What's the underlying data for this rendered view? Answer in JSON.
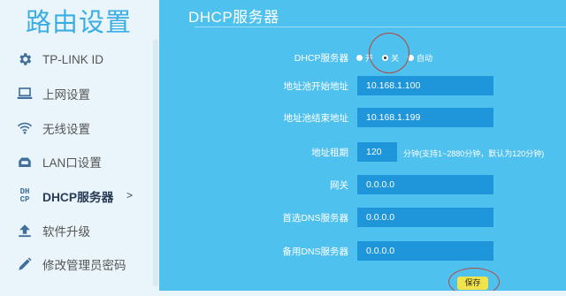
{
  "sidebar": {
    "title": "路由设置",
    "items": [
      {
        "label": "TP-LINK ID",
        "icon": "gear-icon"
      },
      {
        "label": "上网设置",
        "icon": "laptop-icon"
      },
      {
        "label": "无线设置",
        "icon": "wifi-icon"
      },
      {
        "label": "LAN口设置",
        "icon": "lan-port-icon"
      },
      {
        "label": "DHCP服务器",
        "icon": "dhcp-icon",
        "icon_text_top": "DH",
        "icon_text_bottom": "CP",
        "arrow": ">",
        "active": true
      },
      {
        "label": "软件升级",
        "icon": "upload-icon"
      },
      {
        "label": "修改管理员密码",
        "icon": "pencil-icon"
      }
    ]
  },
  "main": {
    "title": "DHCP服务器",
    "dhcp_server": {
      "label": "DHCP服务器",
      "options": [
        "开",
        "关",
        "自动"
      ],
      "selected": "关"
    },
    "fields": [
      {
        "label": "地址池开始地址",
        "value": "10.168.1.100"
      },
      {
        "label": "地址池结束地址",
        "value": "10.168.1.199"
      },
      {
        "label": "地址租期",
        "value": "120",
        "hint": "分钟(支持1~2880分钟，默认为120分钟)"
      },
      {
        "label": "网关",
        "value": "0.0.0.0"
      },
      {
        "label": "首选DNS服务器",
        "value": "0.0.0.0"
      },
      {
        "label": "备用DNS服务器",
        "value": "0.0.0.0"
      }
    ],
    "save_label": "保存"
  },
  "colors": {
    "background": "#4fc1ee",
    "input_bg": "#1f96d9",
    "sidebar_bg": "#eaf5fb",
    "accent_title": "#3aaee2",
    "save_button": "#f3e34a",
    "annotation_circle": "#b5483f"
  }
}
